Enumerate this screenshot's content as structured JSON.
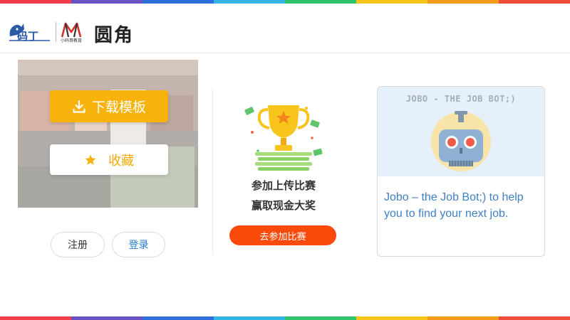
{
  "colors": {
    "rainbow": [
      "#f03c4b",
      "#6a52c4",
      "#2f6fdc",
      "#33b5e5",
      "#2fc36b",
      "#f7c518",
      "#f59b1a",
      "#f04b3b"
    ],
    "download_button": "#f7b30c",
    "favorite_text": "#f2a900",
    "login_text": "#1e7bd6",
    "contest_button": "#fa4b0c",
    "card_text": "#3f7fc4"
  },
  "header": {
    "logo_m_caption": "小码哥教育",
    "title": "圆角"
  },
  "preview": {
    "download_label": "下载模板",
    "favorite_label": "收藏",
    "icons": [
      "download-icon",
      "star-icon"
    ]
  },
  "auth": {
    "register_label": "注册",
    "login_label": "登录"
  },
  "contest": {
    "line1": "参加上传比赛",
    "line2": "赢取现金大奖",
    "button_label": "去参加比赛",
    "icon": "trophy-icon"
  },
  "card": {
    "title": "JOBO - THE JOB BOT;)",
    "description": "Jobo – the Job Bot;) to help you to find your next job.",
    "icon": "robot-icon"
  }
}
